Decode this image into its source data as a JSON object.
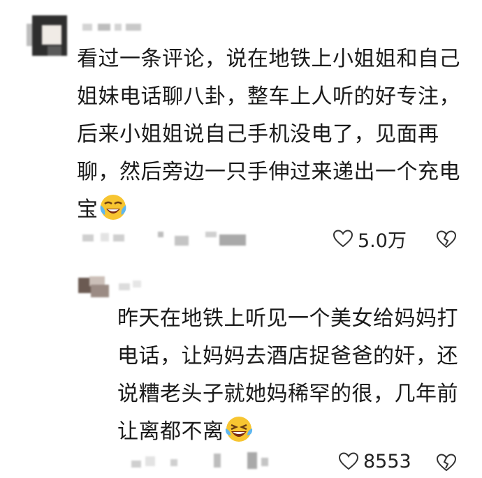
{
  "comments": [
    {
      "text": "看过一条评论，说在地铁上小姐姐和自己姐妹电话聊八卦，整车上人听的好专注，后来小姐姐说自己手机没电了，见面再聊，然后旁边一只手伸过来递出一个充电宝",
      "likes": "5.0万",
      "emoji": "crying-laughing-emoji"
    },
    {
      "text": "昨天在地铁上听见一个美女给妈妈打电话，让妈妈去酒店捉爸爸的奸，还说糟老头子就她妈稀罕的很，几年前让离都不离",
      "likes": "8553",
      "emoji": "laughing-tears-emoji"
    }
  ],
  "icons": {
    "like": "heart-icon",
    "dislike": "broken-heart-icon"
  }
}
